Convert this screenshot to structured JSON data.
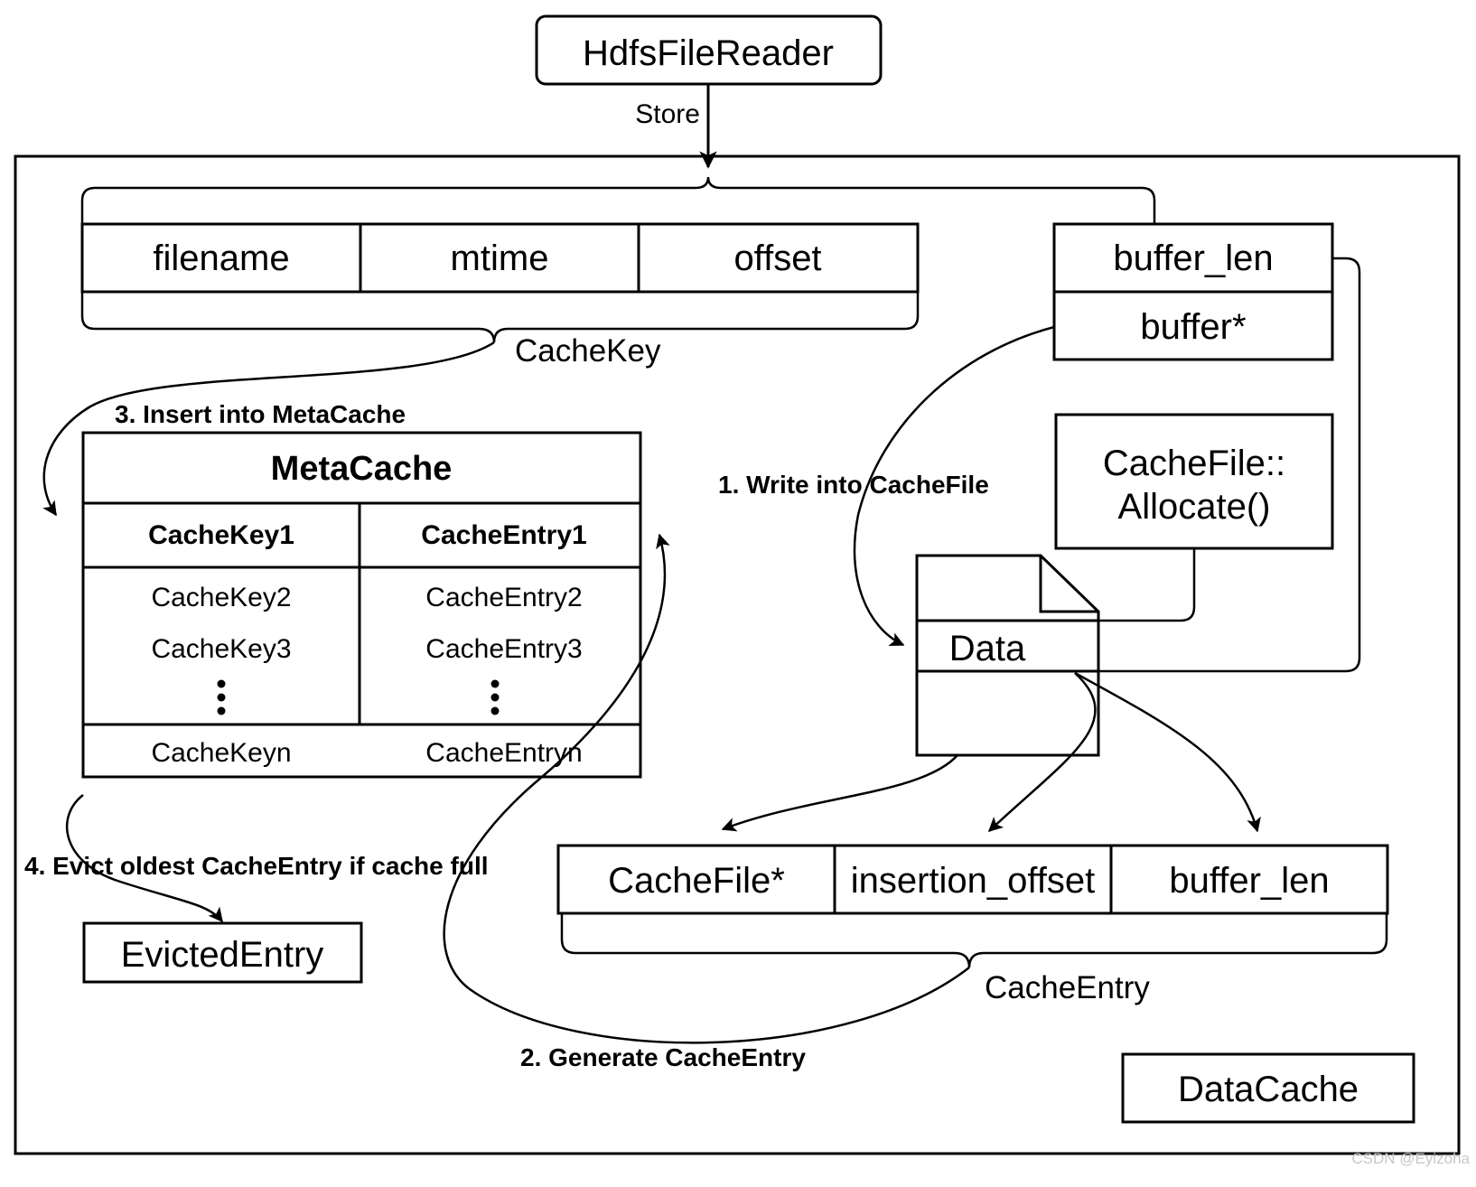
{
  "diagram": {
    "title_node": {
      "label": "HdfsFileReader"
    },
    "edges": {
      "store": "Store",
      "step1": "1. Write into CacheFile",
      "step2": "2. Generate CacheEntry",
      "step3": "3. Insert into MetaCache",
      "step4": "4. Evict oldest CacheEntry if cache full"
    },
    "cache_key": {
      "brace_label": "CacheKey",
      "fields": [
        "filename",
        "mtime",
        "offset"
      ]
    },
    "buffer_struct": {
      "fields": [
        "buffer_len",
        "buffer*"
      ]
    },
    "allocate_node": {
      "line1": "CacheFile::",
      "line2": "Allocate()"
    },
    "data_node": {
      "label": "Data"
    },
    "meta_cache": {
      "title": "MetaCache",
      "header_row": [
        "CacheKey1",
        "CacheEntry1"
      ],
      "rows": [
        [
          "CacheKey2",
          "CacheEntry2"
        ],
        [
          "CacheKey3",
          "CacheEntry3"
        ]
      ],
      "ellipsis": "⋮",
      "last_row": [
        "CacheKeyn",
        "CacheEntryn"
      ]
    },
    "evicted_node": {
      "label": "EvictedEntry"
    },
    "cache_entry": {
      "brace_label": "CacheEntry",
      "fields": [
        "CacheFile*",
        "insertion_offset",
        "buffer_len"
      ]
    },
    "data_cache_container": {
      "label": "DataCache"
    },
    "watermark": "CSDN @Eyizoha",
    "colors": {
      "stroke": "#000000",
      "fill": "#ffffff",
      "watermark": "#c8c8c8"
    }
  }
}
